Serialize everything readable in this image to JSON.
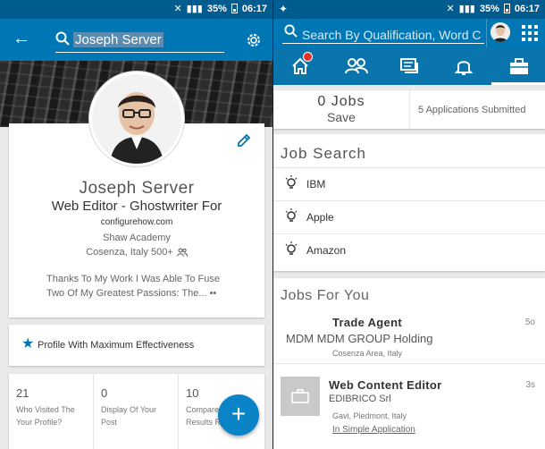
{
  "left": {
    "status": {
      "signal": "≋ᵢ",
      "battery": "35%",
      "time": "06:17"
    },
    "search": {
      "query": "Joseph Server"
    },
    "profile": {
      "name": "Joseph Server",
      "headline": "Web Editor - Ghostwriter For",
      "website": "configurehow.com",
      "school": "Shaw Academy",
      "location": "Cosenza, Italy 500+",
      "summary": "Thanks To My Work I Was Able To Fuse Two Of My Greatest Passions: The... ••"
    },
    "strength": {
      "label": "Profile With Maximum Effectiveness"
    },
    "stats": [
      {
        "value": "21",
        "label": "Who Visited The Your Profile?"
      },
      {
        "value": "0",
        "label": "Display Of Your Post"
      },
      {
        "value": "10",
        "label": "Compare In The Results Research"
      }
    ],
    "fab": {
      "label": "+"
    }
  },
  "right": {
    "status": {
      "battery": "35%",
      "time": "06:17"
    },
    "search": {
      "placeholder": "Search By Qualification, Word Chia..."
    },
    "saved": {
      "count": "0 Jobs",
      "label": "Save",
      "applied": "5 Applications Submitted"
    },
    "job_search": {
      "title": "Job Search",
      "items": [
        "IBM",
        "Apple",
        "Amazon"
      ]
    },
    "jobs_for_you": {
      "title": "Jobs For You",
      "jobs": [
        {
          "title": "Trade Agent",
          "company": "MDM MDM GROUP Holding",
          "location": "Cosenza Area, Italy",
          "age": "5o"
        },
        {
          "title": "Web Content Editor",
          "company": "EDIBRICO Srl",
          "location": "Gavi, Piedmont, Italy",
          "age": "3s",
          "apply": "In Simple Application"
        }
      ]
    }
  },
  "colors": {
    "brand": "#0077b5",
    "status": "#005b8f",
    "badge": "#e4322b"
  }
}
